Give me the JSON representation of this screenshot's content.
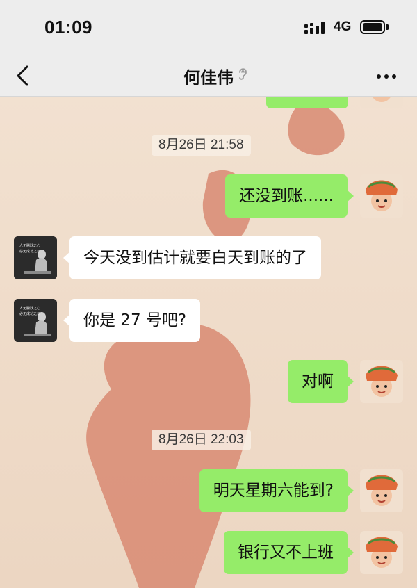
{
  "status_bar": {
    "time": "01:09",
    "network": "4G"
  },
  "nav": {
    "title": "何佳伟"
  },
  "messages": [
    {
      "kind": "timestamp",
      "text": "8月26日 21:58"
    },
    {
      "kind": "self",
      "text": "还没到账......"
    },
    {
      "kind": "other",
      "text": "今天没到估计就要白天到账的了"
    },
    {
      "kind": "other",
      "text": "你是 27 号吧?"
    },
    {
      "kind": "self",
      "text": "对啊"
    },
    {
      "kind": "timestamp",
      "text": "8月26日 22:03"
    },
    {
      "kind": "self",
      "text": "明天星期六能到?"
    },
    {
      "kind": "self",
      "text": "银行又不上班"
    }
  ],
  "other_avatar_caption": [
    "人无腾跃之心",
    "必无成功之日"
  ],
  "colors": {
    "self_bubble": "#95ec69",
    "other_bubble": "#ffffff",
    "wallpaper": "#efdcc9",
    "heart": "#d88a72"
  }
}
